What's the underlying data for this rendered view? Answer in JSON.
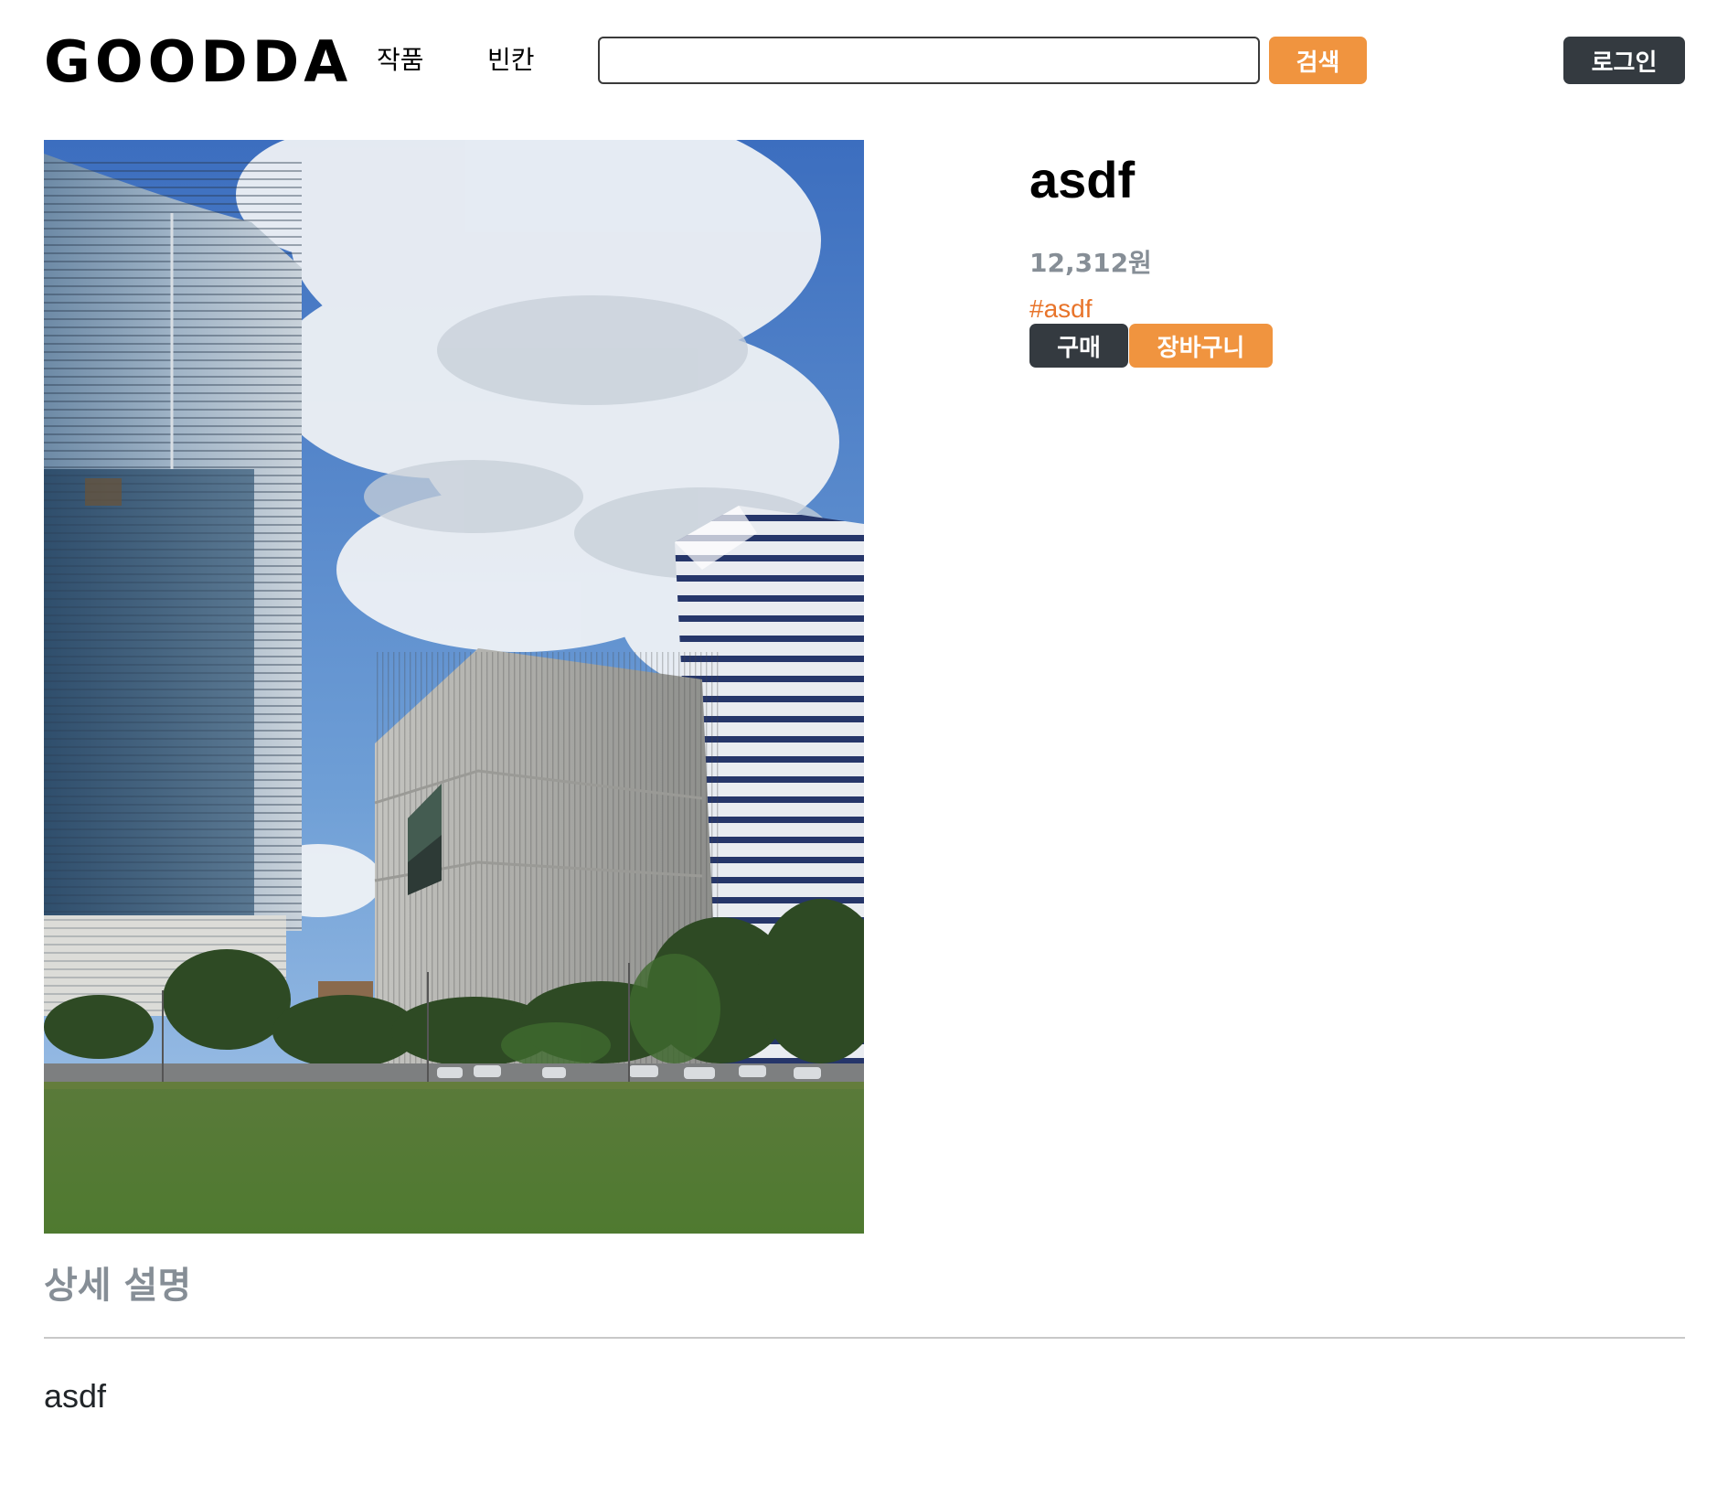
{
  "header": {
    "logo": "GOODDA",
    "nav": [
      {
        "label": "작품"
      },
      {
        "label": "빈칸"
      }
    ],
    "search": {
      "value": "",
      "placeholder": "",
      "button_label": "검색"
    },
    "login_label": "로그인"
  },
  "product": {
    "title": "asdf",
    "price": "12,312원",
    "tag": "#asdf",
    "buy_label": "구매",
    "cart_label": "장바구니"
  },
  "description": {
    "heading": "상세 설명",
    "body": "asdf"
  },
  "colors": {
    "accent_orange": "#f0943f",
    "dark_button": "#343a40",
    "muted_gray": "#868e96",
    "tag_orange": "#e8742a"
  },
  "icons": []
}
